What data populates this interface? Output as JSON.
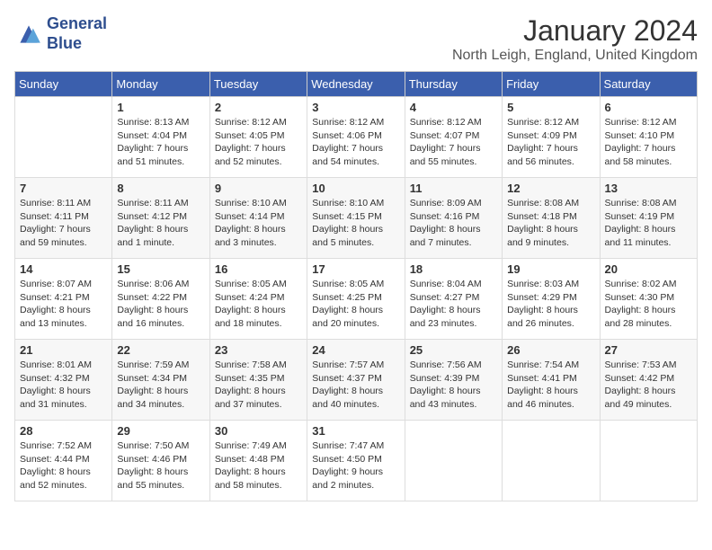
{
  "header": {
    "logo_line1": "General",
    "logo_line2": "Blue",
    "title": "January 2024",
    "subtitle": "North Leigh, England, United Kingdom"
  },
  "weekdays": [
    "Sunday",
    "Monday",
    "Tuesday",
    "Wednesday",
    "Thursday",
    "Friday",
    "Saturday"
  ],
  "weeks": [
    [
      {
        "day": "",
        "sunrise": "",
        "sunset": "",
        "daylight": ""
      },
      {
        "day": "1",
        "sunrise": "Sunrise: 8:13 AM",
        "sunset": "Sunset: 4:04 PM",
        "daylight": "Daylight: 7 hours and 51 minutes."
      },
      {
        "day": "2",
        "sunrise": "Sunrise: 8:12 AM",
        "sunset": "Sunset: 4:05 PM",
        "daylight": "Daylight: 7 hours and 52 minutes."
      },
      {
        "day": "3",
        "sunrise": "Sunrise: 8:12 AM",
        "sunset": "Sunset: 4:06 PM",
        "daylight": "Daylight: 7 hours and 54 minutes."
      },
      {
        "day": "4",
        "sunrise": "Sunrise: 8:12 AM",
        "sunset": "Sunset: 4:07 PM",
        "daylight": "Daylight: 7 hours and 55 minutes."
      },
      {
        "day": "5",
        "sunrise": "Sunrise: 8:12 AM",
        "sunset": "Sunset: 4:09 PM",
        "daylight": "Daylight: 7 hours and 56 minutes."
      },
      {
        "day": "6",
        "sunrise": "Sunrise: 8:12 AM",
        "sunset": "Sunset: 4:10 PM",
        "daylight": "Daylight: 7 hours and 58 minutes."
      }
    ],
    [
      {
        "day": "7",
        "sunrise": "Sunrise: 8:11 AM",
        "sunset": "Sunset: 4:11 PM",
        "daylight": "Daylight: 7 hours and 59 minutes."
      },
      {
        "day": "8",
        "sunrise": "Sunrise: 8:11 AM",
        "sunset": "Sunset: 4:12 PM",
        "daylight": "Daylight: 8 hours and 1 minute."
      },
      {
        "day": "9",
        "sunrise": "Sunrise: 8:10 AM",
        "sunset": "Sunset: 4:14 PM",
        "daylight": "Daylight: 8 hours and 3 minutes."
      },
      {
        "day": "10",
        "sunrise": "Sunrise: 8:10 AM",
        "sunset": "Sunset: 4:15 PM",
        "daylight": "Daylight: 8 hours and 5 minutes."
      },
      {
        "day": "11",
        "sunrise": "Sunrise: 8:09 AM",
        "sunset": "Sunset: 4:16 PM",
        "daylight": "Daylight: 8 hours and 7 minutes."
      },
      {
        "day": "12",
        "sunrise": "Sunrise: 8:08 AM",
        "sunset": "Sunset: 4:18 PM",
        "daylight": "Daylight: 8 hours and 9 minutes."
      },
      {
        "day": "13",
        "sunrise": "Sunrise: 8:08 AM",
        "sunset": "Sunset: 4:19 PM",
        "daylight": "Daylight: 8 hours and 11 minutes."
      }
    ],
    [
      {
        "day": "14",
        "sunrise": "Sunrise: 8:07 AM",
        "sunset": "Sunset: 4:21 PM",
        "daylight": "Daylight: 8 hours and 13 minutes."
      },
      {
        "day": "15",
        "sunrise": "Sunrise: 8:06 AM",
        "sunset": "Sunset: 4:22 PM",
        "daylight": "Daylight: 8 hours and 16 minutes."
      },
      {
        "day": "16",
        "sunrise": "Sunrise: 8:05 AM",
        "sunset": "Sunset: 4:24 PM",
        "daylight": "Daylight: 8 hours and 18 minutes."
      },
      {
        "day": "17",
        "sunrise": "Sunrise: 8:05 AM",
        "sunset": "Sunset: 4:25 PM",
        "daylight": "Daylight: 8 hours and 20 minutes."
      },
      {
        "day": "18",
        "sunrise": "Sunrise: 8:04 AM",
        "sunset": "Sunset: 4:27 PM",
        "daylight": "Daylight: 8 hours and 23 minutes."
      },
      {
        "day": "19",
        "sunrise": "Sunrise: 8:03 AM",
        "sunset": "Sunset: 4:29 PM",
        "daylight": "Daylight: 8 hours and 26 minutes."
      },
      {
        "day": "20",
        "sunrise": "Sunrise: 8:02 AM",
        "sunset": "Sunset: 4:30 PM",
        "daylight": "Daylight: 8 hours and 28 minutes."
      }
    ],
    [
      {
        "day": "21",
        "sunrise": "Sunrise: 8:01 AM",
        "sunset": "Sunset: 4:32 PM",
        "daylight": "Daylight: 8 hours and 31 minutes."
      },
      {
        "day": "22",
        "sunrise": "Sunrise: 7:59 AM",
        "sunset": "Sunset: 4:34 PM",
        "daylight": "Daylight: 8 hours and 34 minutes."
      },
      {
        "day": "23",
        "sunrise": "Sunrise: 7:58 AM",
        "sunset": "Sunset: 4:35 PM",
        "daylight": "Daylight: 8 hours and 37 minutes."
      },
      {
        "day": "24",
        "sunrise": "Sunrise: 7:57 AM",
        "sunset": "Sunset: 4:37 PM",
        "daylight": "Daylight: 8 hours and 40 minutes."
      },
      {
        "day": "25",
        "sunrise": "Sunrise: 7:56 AM",
        "sunset": "Sunset: 4:39 PM",
        "daylight": "Daylight: 8 hours and 43 minutes."
      },
      {
        "day": "26",
        "sunrise": "Sunrise: 7:54 AM",
        "sunset": "Sunset: 4:41 PM",
        "daylight": "Daylight: 8 hours and 46 minutes."
      },
      {
        "day": "27",
        "sunrise": "Sunrise: 7:53 AM",
        "sunset": "Sunset: 4:42 PM",
        "daylight": "Daylight: 8 hours and 49 minutes."
      }
    ],
    [
      {
        "day": "28",
        "sunrise": "Sunrise: 7:52 AM",
        "sunset": "Sunset: 4:44 PM",
        "daylight": "Daylight: 8 hours and 52 minutes."
      },
      {
        "day": "29",
        "sunrise": "Sunrise: 7:50 AM",
        "sunset": "Sunset: 4:46 PM",
        "daylight": "Daylight: 8 hours and 55 minutes."
      },
      {
        "day": "30",
        "sunrise": "Sunrise: 7:49 AM",
        "sunset": "Sunset: 4:48 PM",
        "daylight": "Daylight: 8 hours and 58 minutes."
      },
      {
        "day": "31",
        "sunrise": "Sunrise: 7:47 AM",
        "sunset": "Sunset: 4:50 PM",
        "daylight": "Daylight: 9 hours and 2 minutes."
      },
      {
        "day": "",
        "sunrise": "",
        "sunset": "",
        "daylight": ""
      },
      {
        "day": "",
        "sunrise": "",
        "sunset": "",
        "daylight": ""
      },
      {
        "day": "",
        "sunrise": "",
        "sunset": "",
        "daylight": ""
      }
    ]
  ]
}
